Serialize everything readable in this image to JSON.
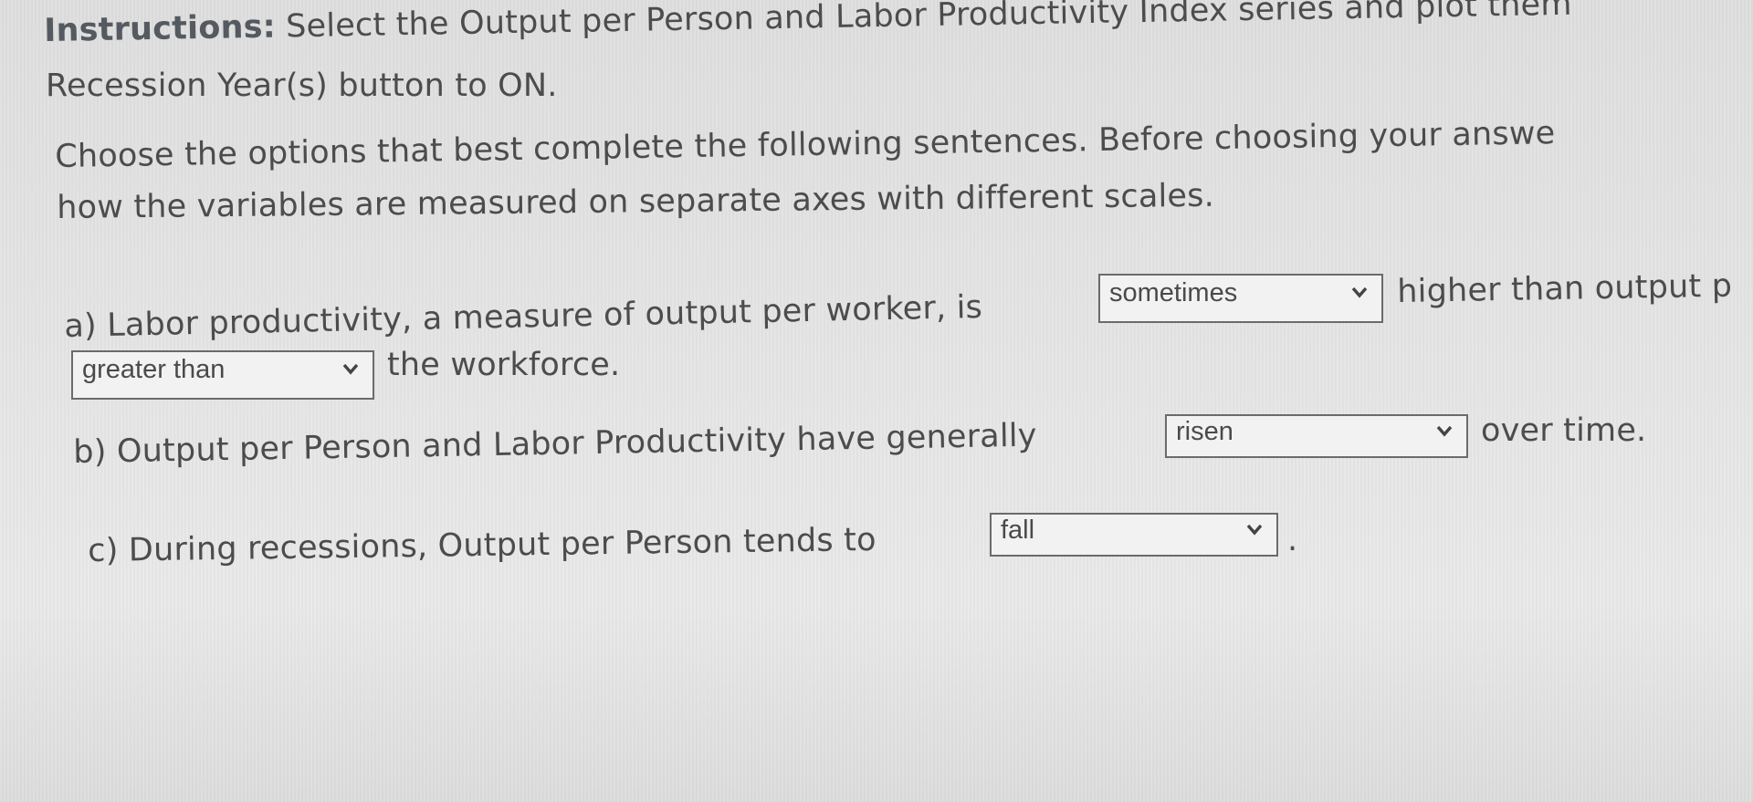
{
  "instructions": {
    "label": "Instructions:",
    "line1": "Select the Output per Person and Labor Productivity Index series and plot them",
    "line2": "Recession Year(s) button to ON."
  },
  "intro": {
    "line1": "Choose the options that best complete the following sentences. Before choosing your answe",
    "line2": "how the variables are measured on separate axes with different scales."
  },
  "question_a": {
    "part1": "a) Labor productivity, a measure of output per worker, is",
    "dropdown1_value": "sometimes",
    "part2": "higher than output p",
    "dropdown2_value": "greater than",
    "part3": "the workforce."
  },
  "question_b": {
    "part1": "b) Output per Person and Labor Productivity have generally",
    "dropdown_value": "risen",
    "part2": "over time."
  },
  "question_c": {
    "part1": "c) During recessions, Output per Person tends to",
    "dropdown_value": "fall",
    "part2": "."
  },
  "icons": {
    "dropdown_chevron": "chevron-down-icon"
  },
  "colors": {
    "text": "#4c4c4c",
    "dropdown_border": "#6b6b6b",
    "dropdown_bg": "#f2f2f2"
  }
}
